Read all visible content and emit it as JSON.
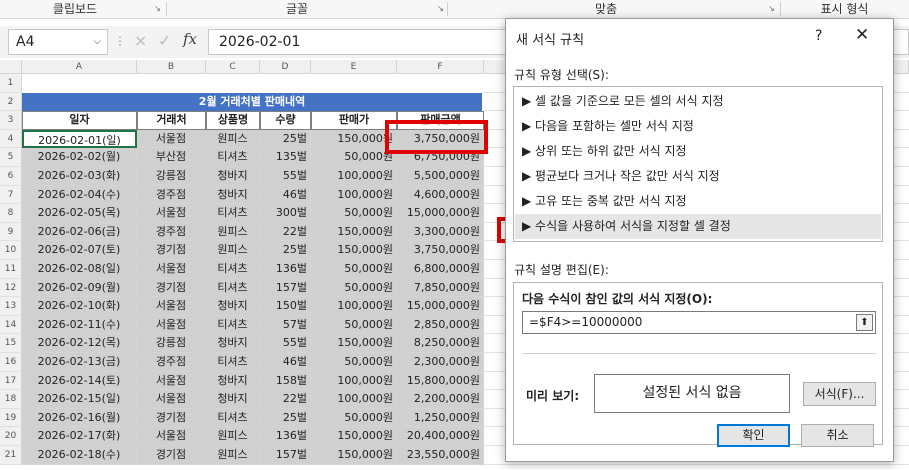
{
  "ribbon": {
    "groups": [
      "클립보드",
      "글꼴",
      "맞춤",
      "표시 형식"
    ]
  },
  "formula_bar": {
    "name_box": "A4",
    "cancel_icon": "×",
    "enter_icon": "✓",
    "fx_label": "fx",
    "formula": "2026-02-01"
  },
  "sheet": {
    "columns": [
      "A",
      "B",
      "C",
      "D",
      "E",
      "F"
    ],
    "rows": [
      "1",
      "2",
      "3",
      "4",
      "5",
      "6",
      "7",
      "8",
      "9",
      "10",
      "11",
      "12",
      "13",
      "14",
      "15",
      "16",
      "17",
      "18",
      "19",
      "20",
      "21"
    ],
    "title": "2월 거래처별 판매내역",
    "headers": [
      "일자",
      "거래처",
      "상품명",
      "수량",
      "판매가",
      "판매금액"
    ],
    "data": [
      [
        "2026-02-01(일)",
        "서울점",
        "원피스",
        "25벌",
        "150,000원",
        "3,750,000원"
      ],
      [
        "2026-02-02(월)",
        "부산점",
        "티셔츠",
        "135벌",
        "50,000원",
        "6,750,000원"
      ],
      [
        "2026-02-03(화)",
        "강릉점",
        "청바지",
        "55벌",
        "100,000원",
        "5,500,000원"
      ],
      [
        "2026-02-04(수)",
        "경주점",
        "청바지",
        "46벌",
        "100,000원",
        "4,600,000원"
      ],
      [
        "2026-02-05(목)",
        "서울점",
        "티셔츠",
        "300벌",
        "50,000원",
        "15,000,000원"
      ],
      [
        "2026-02-06(금)",
        "경주점",
        "원피스",
        "22벌",
        "150,000원",
        "3,300,000원"
      ],
      [
        "2026-02-07(토)",
        "경기점",
        "원피스",
        "25벌",
        "150,000원",
        "3,750,000원"
      ],
      [
        "2026-02-08(일)",
        "서울점",
        "티셔츠",
        "136벌",
        "50,000원",
        "6,800,000원"
      ],
      [
        "2026-02-09(월)",
        "경기점",
        "티셔츠",
        "157벌",
        "50,000원",
        "7,850,000원"
      ],
      [
        "2026-02-10(화)",
        "서울점",
        "청바지",
        "150벌",
        "100,000원",
        "15,000,000원"
      ],
      [
        "2026-02-11(수)",
        "서울점",
        "티셔츠",
        "57벌",
        "50,000원",
        "2,850,000원"
      ],
      [
        "2026-02-12(목)",
        "강릉점",
        "청바지",
        "55벌",
        "150,000원",
        "8,250,000원"
      ],
      [
        "2026-02-13(금)",
        "경주점",
        "티셔츠",
        "46벌",
        "50,000원",
        "2,300,000원"
      ],
      [
        "2026-02-14(토)",
        "서울점",
        "청바지",
        "158벌",
        "100,000원",
        "15,800,000원"
      ],
      [
        "2026-02-15(일)",
        "서울점",
        "청바지",
        "22벌",
        "100,000원",
        "2,200,000원"
      ],
      [
        "2026-02-16(월)",
        "경기점",
        "티셔츠",
        "25벌",
        "50,000원",
        "1,250,000원"
      ],
      [
        "2026-02-17(화)",
        "서울점",
        "원피스",
        "136벌",
        "150,000원",
        "20,400,000원"
      ],
      [
        "2026-02-18(수)",
        "경기점",
        "원피스",
        "157벌",
        "150,000원",
        "23,550,000원"
      ]
    ]
  },
  "dialog": {
    "title": "새 서식 규칙",
    "help": "?",
    "close": "✕",
    "rule_type_label": "규칙 유형 선택(S):",
    "rules": [
      "▶ 셀 값을 기준으로 모든 셀의 서식 지정",
      "▶ 다음을 포함하는 셀만 서식 지정",
      "▶ 상위 또는 하위 값만 서식 지정",
      "▶ 평균보다 크거나 작은 값만 서식 지정",
      "▶ 고유 또는 중복 값만 서식 지정",
      "▶ 수식을 사용하여 서식을 지정할 셀 결정"
    ],
    "edit_label": "규칙 설명 편집(E):",
    "formula_label": "다음 수식이 참인 값의 서식 지정(O):",
    "formula_value": "=$F4>=10000000",
    "preview_label": "미리 보기:",
    "preview_text": "설정된 서식 없음",
    "format_button": "서식(F)...",
    "ok_button": "확인",
    "cancel_button": "취소"
  },
  "colors": {
    "title_bg": "#4472c4",
    "data_bg": "#d0d0d0",
    "highlight": "#e00000",
    "selection": "#217346"
  }
}
